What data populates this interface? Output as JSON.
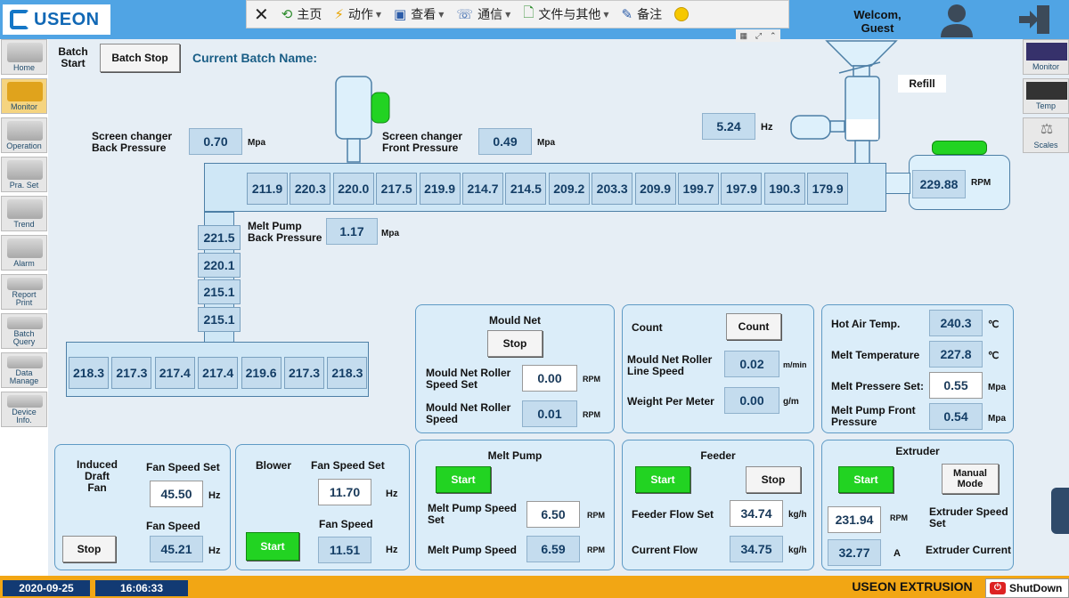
{
  "header": {
    "brand": "USEON",
    "welcome": "Welcom,",
    "user": "Guest",
    "toolbar": [
      {
        "label": "主页",
        "icon": "home-icon",
        "dropdown": false
      },
      {
        "label": "动作",
        "icon": "lightning-icon",
        "dropdown": true
      },
      {
        "label": "查看",
        "icon": "view-icon",
        "dropdown": true
      },
      {
        "label": "通信",
        "icon": "phone-icon",
        "dropdown": true
      },
      {
        "label": "文件与其他",
        "icon": "file-icon",
        "dropdown": true
      },
      {
        "label": "备注",
        "icon": "note-icon",
        "dropdown": false
      }
    ]
  },
  "sidebar": {
    "items": [
      "Home",
      "Monitor",
      "Operation",
      "Pra. Set",
      "Trend",
      "Alarm",
      "Report\nPrint",
      "Batch\nQuery",
      "Data\nManage",
      "Device\nInfo."
    ]
  },
  "rightbar": {
    "items": [
      "Monitor",
      "Temp",
      "Scales"
    ]
  },
  "batch": {
    "start": "Batch\nStart",
    "stop": "Batch Stop",
    "name_label": "Current Batch Name:"
  },
  "process": {
    "refill": "Refill",
    "hz_value": "5.24",
    "hz_unit": "Hz",
    "rpm_value": "229.88",
    "rpm_unit": "RPM",
    "screen_back_label": "Screen changer\nBack Pressure",
    "screen_back_value": "0.70",
    "screen_back_unit": "Mpa",
    "screen_front_label": "Screen changer\nFront Pressure",
    "screen_front_value": "0.49",
    "screen_front_unit": "Mpa",
    "melt_back_label": "Melt Pump\nBack Pressure",
    "melt_back_value": "1.17",
    "melt_back_unit": "Mpa",
    "barrel_temps": [
      "211.9",
      "220.3",
      "220.0",
      "217.5",
      "219.9",
      "214.7",
      "214.5",
      "209.2",
      "203.3",
      "209.9",
      "199.7",
      "197.9",
      "190.3",
      "179.9"
    ],
    "vertical_temps": [
      "221.5",
      "220.1",
      "215.1",
      "215.1"
    ],
    "die_temps": [
      "218.3",
      "217.3",
      "217.4",
      "217.4",
      "219.6",
      "217.3",
      "218.3"
    ]
  },
  "mould_net": {
    "title": "Mould Net",
    "stop": "Stop",
    "roller_set_label": "Mould Net Roller\nSpeed Set",
    "roller_set_value": "0.00",
    "roller_set_unit": "RPM",
    "roller_speed_label": "Mould Net Roller\nSpeed",
    "roller_speed_value": "0.01",
    "roller_speed_unit": "RPM"
  },
  "count": {
    "label": "Count",
    "button": "Count",
    "line_label": "Mould Net Roller\nLine Speed",
    "line_value": "0.02",
    "line_unit": "m/min",
    "weight_label": "Weight Per Meter",
    "weight_value": "0.00",
    "weight_unit": "g/m"
  },
  "temps": {
    "hot_air_label": "Hot Air Temp.",
    "hot_air_value": "240.3",
    "hot_air_unit": "℃",
    "melt_temp_label": "Melt Temperature",
    "melt_temp_value": "227.8",
    "melt_temp_unit": "℃",
    "melt_press_set_label": "Melt Pressere Set:",
    "melt_press_set_value": "0.55",
    "melt_press_set_unit": "Mpa",
    "melt_front_label": "Melt Pump Front\nPressure",
    "melt_front_value": "0.54",
    "melt_front_unit": "Mpa"
  },
  "induced": {
    "title": "Induced Draft\nFan",
    "set_label": "Fan Speed Set",
    "set_value": "45.50",
    "set_unit": "Hz",
    "speed_label": "Fan Speed",
    "speed_value": "45.21",
    "speed_unit": "Hz",
    "stop": "Stop"
  },
  "blower": {
    "title": "Blower",
    "set_label": "Fan Speed Set",
    "set_value": "11.70",
    "set_unit": "Hz",
    "speed_label": "Fan Speed",
    "speed_value": "11.51",
    "speed_unit": "Hz",
    "start": "Start"
  },
  "melt_pump": {
    "title": "Melt Pump",
    "start": "Start",
    "set_label": "Melt Pump Speed\nSet",
    "set_value": "6.50",
    "set_unit": "RPM",
    "speed_label": "Melt Pump Speed",
    "speed_value": "6.59",
    "speed_unit": "RPM"
  },
  "feeder": {
    "title": "Feeder",
    "start": "Start",
    "stop": "Stop",
    "flow_set_label": "Feeder Flow Set",
    "flow_set_value": "34.74",
    "flow_set_unit": "kg/h",
    "flow_label": "Current Flow",
    "flow_value": "34.75",
    "flow_unit": "kg/h"
  },
  "extruder": {
    "title": "Extruder",
    "start": "Start",
    "mode": "Manual\nMode",
    "speed_value": "231.94",
    "speed_unit": "RPM",
    "speed_label": "Extruder Speed\nSet",
    "current_value": "32.77",
    "current_unit": "A",
    "current_label": "Extruder Current"
  },
  "footer": {
    "date": "2020-09-25",
    "time": "16:06:33",
    "brand": "USEON EXTRUSION",
    "shutdown": "ShutDown"
  },
  "colors": {
    "header": "#50a4e4",
    "start": "#22d322",
    "footer": "#f2a614",
    "panel": "#dbedf9"
  }
}
